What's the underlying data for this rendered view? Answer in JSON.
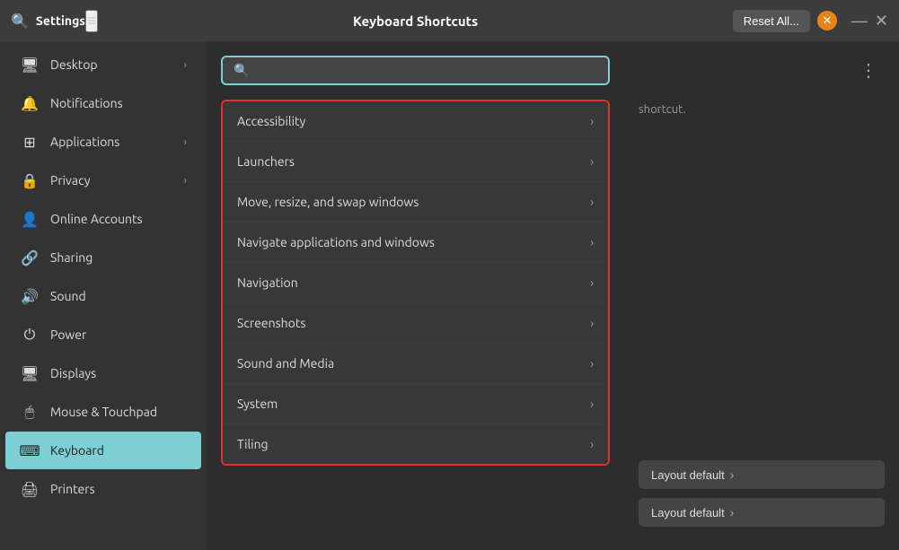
{
  "titlebar": {
    "search_icon": "🔍",
    "app_name": "Settings",
    "hamburger_icon": "≡",
    "title": "Keyboard Shortcuts",
    "reset_button_label": "Reset All...",
    "close_orange_icon": "✕",
    "window_minimize": "—",
    "window_close": "✕"
  },
  "sidebar": {
    "items": [
      {
        "id": "desktop",
        "label": "Desktop",
        "icon": "🖥",
        "has_chevron": true,
        "active": false
      },
      {
        "id": "notifications",
        "label": "Notifications",
        "icon": "🔔",
        "has_chevron": false,
        "active": false
      },
      {
        "id": "applications",
        "label": "Applications",
        "icon": "⊞",
        "has_chevron": true,
        "active": false
      },
      {
        "id": "privacy",
        "label": "Privacy",
        "icon": "🔒",
        "has_chevron": true,
        "active": false
      },
      {
        "id": "online-accounts",
        "label": "Online Accounts",
        "icon": "👤",
        "has_chevron": false,
        "active": false
      },
      {
        "id": "sharing",
        "label": "Sharing",
        "icon": "🔗",
        "has_chevron": false,
        "active": false
      },
      {
        "id": "sound",
        "label": "Sound",
        "icon": "🔊",
        "has_chevron": false,
        "active": false
      },
      {
        "id": "power",
        "label": "Power",
        "icon": "⏻",
        "has_chevron": false,
        "active": false
      },
      {
        "id": "displays",
        "label": "Displays",
        "icon": "🖥",
        "has_chevron": false,
        "active": false
      },
      {
        "id": "mouse-touchpad",
        "label": "Mouse & Touchpad",
        "icon": "🖱",
        "has_chevron": false,
        "active": false
      },
      {
        "id": "keyboard",
        "label": "Keyboard",
        "icon": "⌨",
        "has_chevron": false,
        "active": true
      },
      {
        "id": "printers",
        "label": "Printers",
        "icon": "🖨",
        "has_chevron": false,
        "active": false
      }
    ]
  },
  "search": {
    "placeholder": "",
    "value": ""
  },
  "shortcuts": {
    "items": [
      {
        "label": "Accessibility"
      },
      {
        "label": "Launchers"
      },
      {
        "label": "Move, resize, and swap windows"
      },
      {
        "label": "Navigate applications and windows"
      },
      {
        "label": "Navigation"
      },
      {
        "label": "Screenshots"
      },
      {
        "label": "Sound and Media"
      },
      {
        "label": "System"
      },
      {
        "label": "Tiling"
      }
    ]
  },
  "right_panel": {
    "more_options_icon": "⋮",
    "placeholder_text": "shortcut.",
    "layout_rows": [
      {
        "label": "Layout default"
      },
      {
        "label": "Layout default"
      }
    ]
  }
}
